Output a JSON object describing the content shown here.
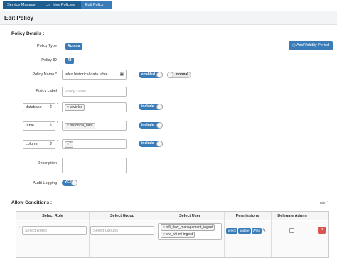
{
  "breadcrumb": [
    "Service Manager",
    "cm_hive Policies",
    "Edit Policy"
  ],
  "page_title": "Edit Policy",
  "policy_details": {
    "heading": "Policy Details :",
    "add_validity_label": "Add Validity Period",
    "policy_type_label": "Policy Type",
    "policy_type_value": "Access",
    "policy_id_label": "Policy ID",
    "policy_id_value": "44",
    "policy_name_label": "Policy Name",
    "policy_name_value": "telco historical data table",
    "enabled_label": "enabled",
    "normal_label": "normal",
    "policy_label_label": "Policy Label",
    "policy_label_placeholder": "Policy Label",
    "resources": [
      {
        "type": "database",
        "value": "wwtelco",
        "include_label": "include"
      },
      {
        "type": "table",
        "value": "historical_data",
        "include_label": "include"
      },
      {
        "type": "column",
        "value": "*",
        "include_label": "include"
      }
    ],
    "description_label": "Description",
    "audit_logging_label": "Audit Logging",
    "audit_logging_value": "YES"
  },
  "allow_conditions": {
    "heading": "Allow Conditions :",
    "hide_label": "hide",
    "columns": [
      "Select Role",
      "Select Group",
      "Select User",
      "Permissions",
      "Delegate Admin"
    ],
    "row": {
      "role_placeholder": "Select Roles",
      "group_placeholder": "Select Groups",
      "users": [
        "nifi_flow_management_ingest",
        "srv_nifi-mi-ingest"
      ],
      "permissions": [
        "select",
        "update",
        "Write"
      ]
    }
  },
  "colors": {
    "primary": "#3a7cb8",
    "breadcrumb_dark": "#1e5d8f",
    "danger": "#d9534f"
  }
}
